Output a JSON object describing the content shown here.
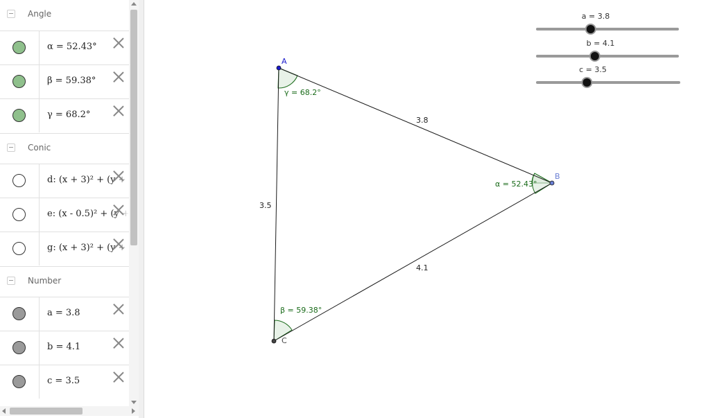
{
  "algebra_view": {
    "groups": {
      "angle": {
        "name": "Angle",
        "items": [
          {
            "text": "α = 52.43°",
            "marble_color": "#8fc08c"
          },
          {
            "text": "β = 59.38°",
            "marble_color": "#8fc08c"
          },
          {
            "text": "γ = 68.2°",
            "marble_color": "#8fc08c"
          }
        ]
      },
      "conic": {
        "name": "Conic",
        "items": [
          {
            "text": "d: (x + 3)² + (y + ",
            "marble_color": "#ffffff"
          },
          {
            "text": "e: (x - 0.5)² + (y + ",
            "marble_color": "#ffffff"
          },
          {
            "text": "g: (x + 3)² + (y + ",
            "marble_color": "#ffffff"
          }
        ]
      },
      "number": {
        "name": "Number",
        "items": [
          {
            "text": "a = 3.8",
            "marble_color": "#9a9a9a"
          },
          {
            "text": "b = 4.1",
            "marble_color": "#9a9a9a"
          },
          {
            "text": "c = 3.5",
            "marble_color": "#9a9a9a"
          }
        ]
      }
    }
  },
  "graphics": {
    "points": {
      "A": {
        "label": "A",
        "color": "#1a1acc"
      },
      "B": {
        "label": "B",
        "color": "#6a7fd4"
      },
      "C": {
        "label": "C",
        "color": "#444444"
      }
    },
    "segments": {
      "AB": {
        "label": "3.8"
      },
      "AC": {
        "label": "3.5"
      },
      "CB": {
        "label": "4.1"
      }
    },
    "angles": {
      "alpha": {
        "label": "α = 52.43°"
      },
      "beta": {
        "label": "β = 59.38°"
      },
      "gamma": {
        "label": "γ = 68.2°"
      }
    },
    "angle_color": "#1a6b1a",
    "sliders": [
      {
        "label": "a = 3.8",
        "value": 3.8,
        "fraction": 0.38
      },
      {
        "label": "b = 4.1",
        "value": 4.1,
        "fraction": 0.41
      },
      {
        "label": "c = 3.5",
        "value": 3.5,
        "fraction": 0.35
      }
    ]
  }
}
